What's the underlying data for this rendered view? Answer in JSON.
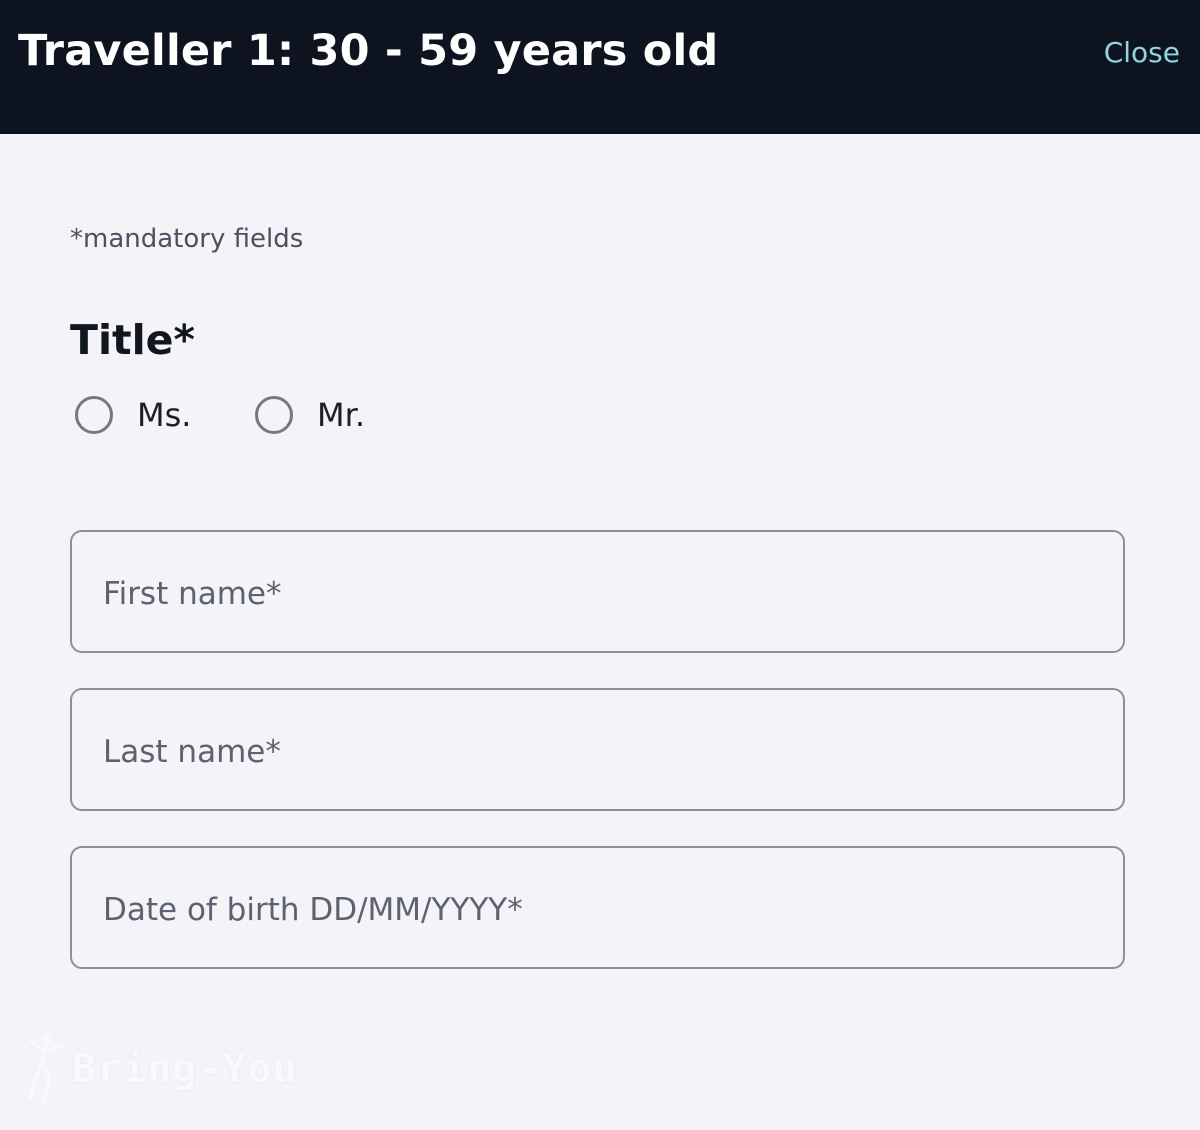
{
  "header": {
    "title": "Traveller 1: 30 - 59 years old",
    "close_label": "Close"
  },
  "form": {
    "mandatory_note": "*mandatory fields",
    "title_label": "Title*",
    "title_options": [
      {
        "label": "Ms.",
        "selected": false
      },
      {
        "label": "Mr.",
        "selected": false
      }
    ],
    "fields": {
      "first_name": {
        "placeholder": "First name*",
        "value": ""
      },
      "last_name": {
        "placeholder": "Last name*",
        "value": ""
      },
      "date_of_birth": {
        "placeholder": "Date of birth DD/MM/YYYY*",
        "value": ""
      }
    }
  },
  "watermark": {
    "text": "Bring-You",
    "icon": "dancer-figure-icon"
  },
  "colors": {
    "header_background": "#0d1420",
    "header_text": "#ffffff",
    "close_link": "#8fd6e0",
    "page_background": "#f3f3f8",
    "field_border": "#8b909b",
    "placeholder_text": "#5c6270"
  }
}
